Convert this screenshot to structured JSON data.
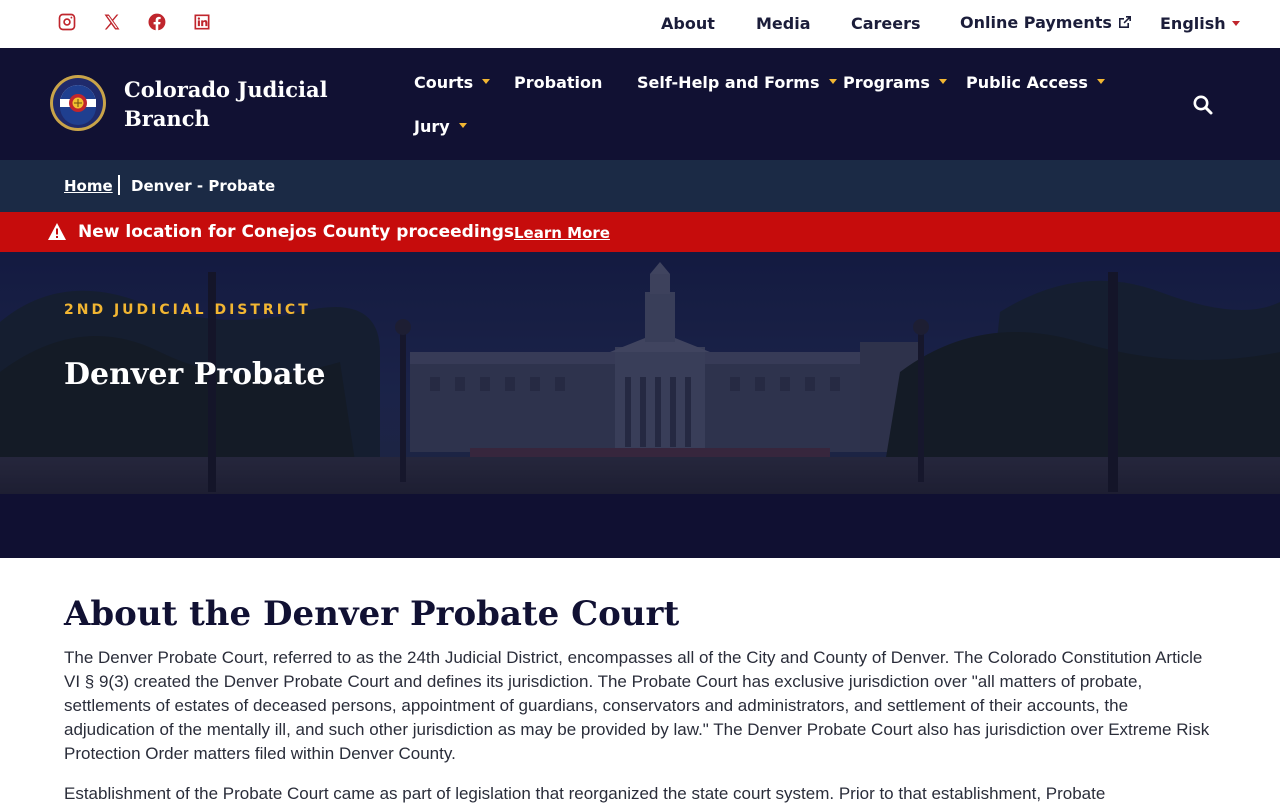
{
  "social": [
    {
      "name": "instagram-icon"
    },
    {
      "name": "x-icon"
    },
    {
      "name": "facebook-icon"
    },
    {
      "name": "linkedin-icon"
    }
  ],
  "utility_nav": {
    "about": "About",
    "media": "Media",
    "careers": "Careers",
    "payments": "Online Payments",
    "language": "English"
  },
  "brand": {
    "name": "Colorado Judicial Branch"
  },
  "main_nav": {
    "courts": "Courts",
    "probation": "Probation",
    "self_help": "Self-Help and Forms",
    "programs": "Programs",
    "public_access": "Public Access",
    "jury": "Jury"
  },
  "breadcrumb": {
    "home": "Home",
    "current": "Denver - Probate"
  },
  "alert": {
    "message": "New location for Conejos County proceedings",
    "link": "Learn More"
  },
  "hero": {
    "kicker": "2ND JUDICIAL DISTRICT",
    "title": "Denver Probate"
  },
  "content": {
    "heading": "About the Denver Probate Court",
    "paragraph1": "The Denver Probate Court, referred to as the 24th Judicial District, encompasses all of the City and County of Denver. The Colorado Constitution Article VI § 9(3) created the Denver Probate Court and defines its jurisdiction. The Probate Court has exclusive jurisdiction over \"all matters of probate, settlements of estates of deceased persons, appointment of guardians, conservators and administrators, and settlement of their accounts, the adjudication of the mentally ill, and such other jurisdiction as may be provided by law.\" The Denver Probate Court also has jurisdiction over Extreme Risk Protection Order matters filed within Denver County.",
    "paragraph2": "Establishment of the Probate Court came as part of legislation that reorganized the state court system. Prior to that establishment, Probate"
  },
  "colors": {
    "navy": "#111133",
    "crumb_bar": "#1b2a45",
    "alert_red": "#c60c0c",
    "gold": "#f2b632",
    "social_red": "#c0262d"
  }
}
